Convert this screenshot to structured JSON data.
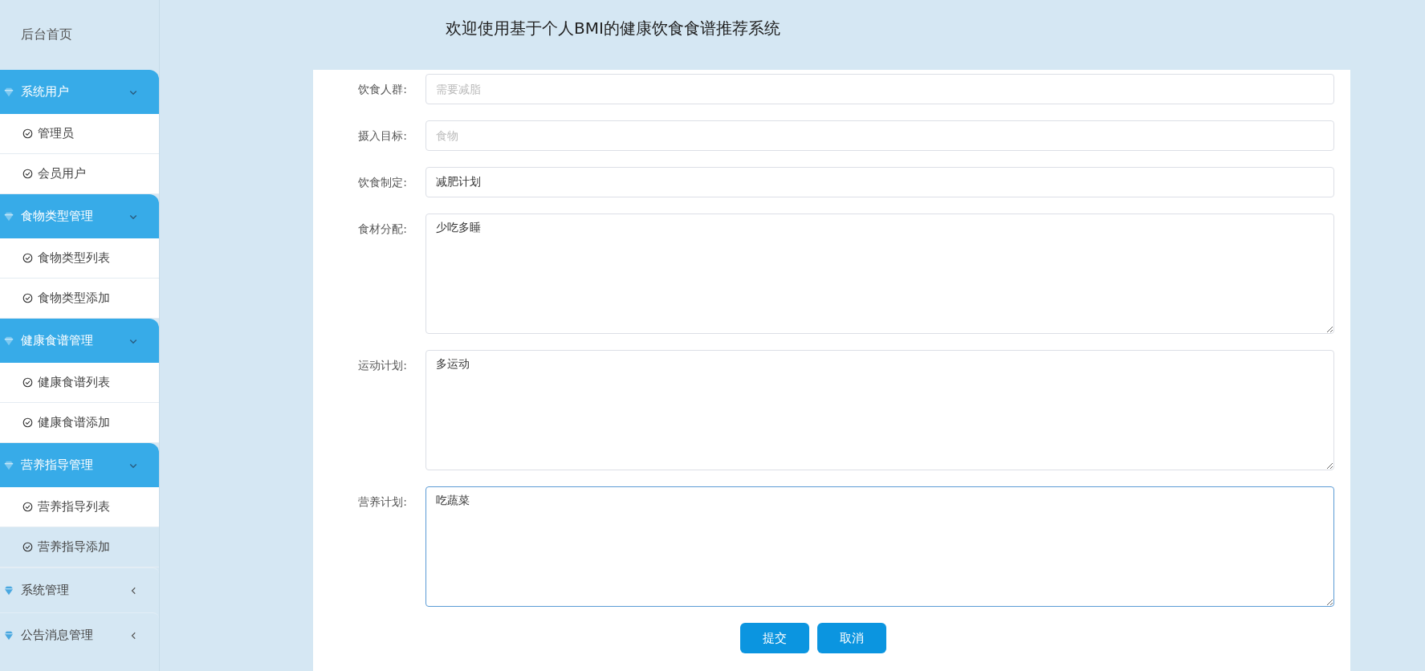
{
  "header": {
    "title": "欢迎使用基于个人BMI的健康饮食食谱推荐系统"
  },
  "sidebar": {
    "home": "后台首页",
    "groups": [
      {
        "label": "系统用户",
        "expanded": true,
        "items": [
          {
            "label": "管理员",
            "selected": false
          },
          {
            "label": "会员用户",
            "selected": false
          }
        ]
      },
      {
        "label": "食物类型管理",
        "expanded": true,
        "items": [
          {
            "label": "食物类型列表",
            "selected": false
          },
          {
            "label": "食物类型添加",
            "selected": false
          }
        ]
      },
      {
        "label": "健康食谱管理",
        "expanded": true,
        "items": [
          {
            "label": "健康食谱列表",
            "selected": false
          },
          {
            "label": "健康食谱添加",
            "selected": false
          }
        ]
      },
      {
        "label": "营养指导管理",
        "expanded": true,
        "items": [
          {
            "label": "营养指导列表",
            "selected": false
          },
          {
            "label": "营养指导添加",
            "selected": true
          }
        ]
      },
      {
        "label": "系统管理",
        "expanded": false
      },
      {
        "label": "公告消息管理",
        "expanded": false
      }
    ]
  },
  "form": {
    "fields": [
      {
        "kind": "input",
        "label": "饮食人群:",
        "placeholder": "需要减脂",
        "focused": false
      },
      {
        "kind": "input",
        "label": "摄入目标:",
        "placeholder": "食物",
        "focused": false
      },
      {
        "kind": "input",
        "label": "饮食制定:",
        "value": "减肥计划",
        "focused": false
      },
      {
        "kind": "textarea",
        "label": "食材分配:",
        "value": "少吃多睡",
        "focused": false
      },
      {
        "kind": "textarea",
        "label": "运动计划:",
        "value": "多运动",
        "focused": false
      },
      {
        "kind": "textarea",
        "label": "营养计划:",
        "value": "吃蔬菜",
        "focused": true
      }
    ],
    "buttons": [
      "提交",
      "取消"
    ]
  }
}
